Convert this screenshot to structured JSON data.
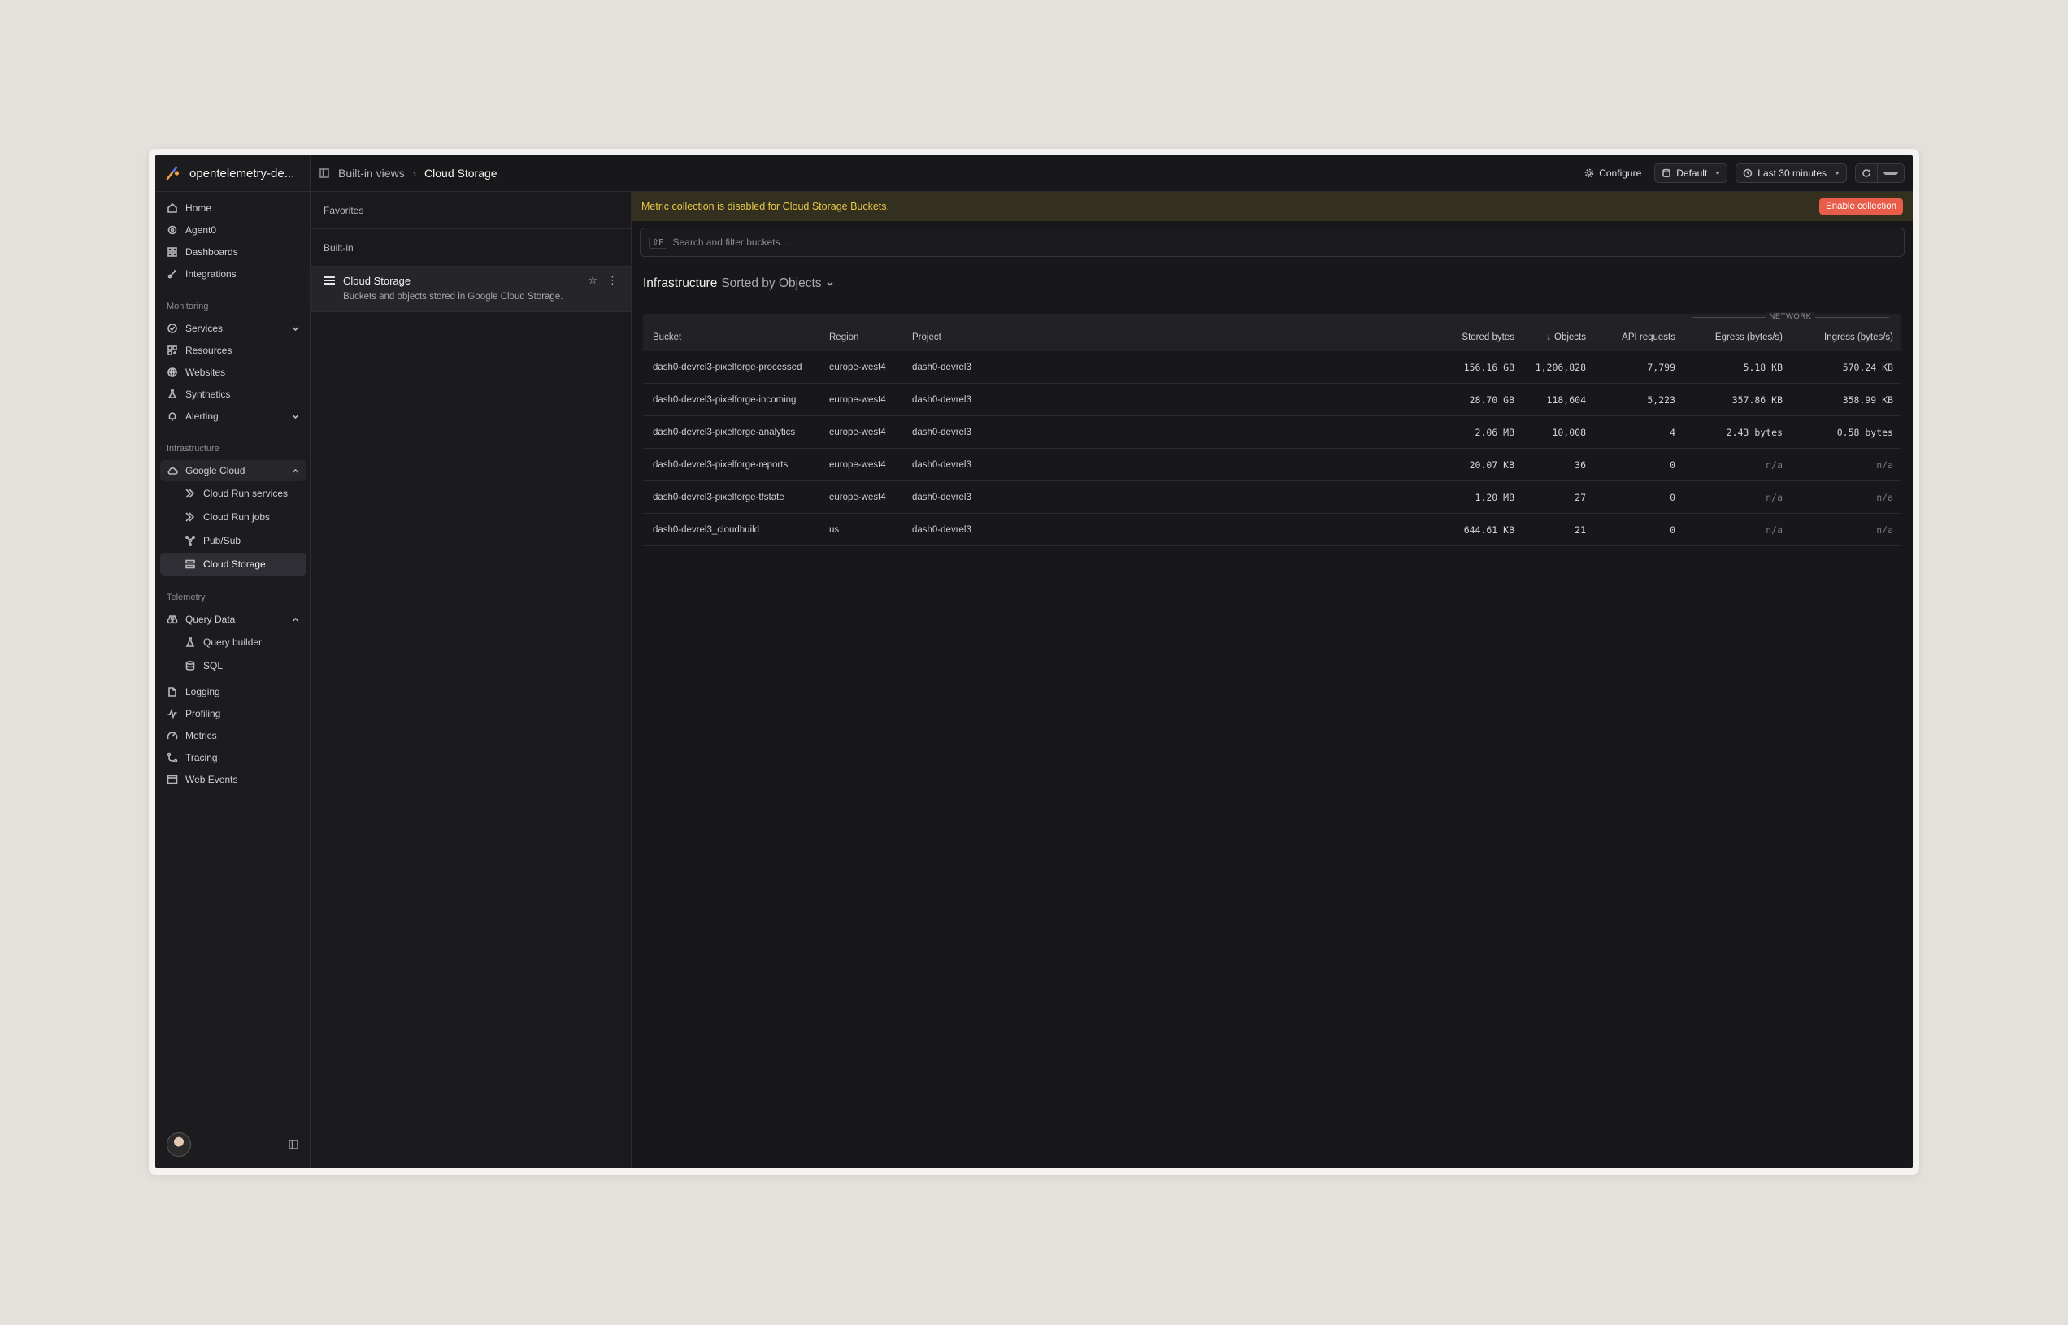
{
  "org": {
    "name": "opentelemetry-de..."
  },
  "sidebar": {
    "top_items": [
      {
        "label": "Home",
        "icon": "home-icon"
      },
      {
        "label": "Agent0",
        "icon": "agent-icon"
      },
      {
        "label": "Dashboards",
        "icon": "dashboards-icon"
      },
      {
        "label": "Integrations",
        "icon": "integrations-icon"
      }
    ],
    "monitoring": {
      "title": "Monitoring",
      "items": [
        {
          "label": "Services",
          "icon": "services-icon"
        },
        {
          "label": "Resources",
          "icon": "resources-icon"
        },
        {
          "label": "Websites",
          "icon": "globe-icon"
        },
        {
          "label": "Synthetics",
          "icon": "synthetics-icon"
        },
        {
          "label": "Alerting",
          "icon": "bell-icon"
        }
      ]
    },
    "infrastructure": {
      "title": "Infrastructure",
      "group": "Google Cloud",
      "items": [
        {
          "label": "Cloud Run services"
        },
        {
          "label": "Cloud Run jobs"
        },
        {
          "label": "Pub/Sub"
        },
        {
          "label": "Cloud Storage"
        }
      ]
    },
    "telemetry": {
      "title": "Telemetry",
      "group": "Query Data",
      "sub_items": [
        {
          "label": "Query builder"
        },
        {
          "label": "SQL"
        }
      ],
      "items": [
        {
          "label": "Logging"
        },
        {
          "label": "Profiling"
        },
        {
          "label": "Metrics"
        },
        {
          "label": "Tracing"
        },
        {
          "label": "Web Events"
        }
      ]
    }
  },
  "breadcrumb": {
    "parent": "Built-in views",
    "separator": "›",
    "current": "Cloud Storage"
  },
  "toolbar": {
    "configure": "Configure",
    "dataset": "Default",
    "time_range": "Last 30 minutes"
  },
  "views": {
    "favorites": "Favorites",
    "builtin": "Built-in",
    "card": {
      "title": "Cloud Storage",
      "desc": "Buckets and objects stored in Google Cloud Storage."
    }
  },
  "banner": {
    "text": "Metric collection is disabled for Cloud Storage Buckets.",
    "button": "Enable collection"
  },
  "search": {
    "shortcut": "⇧F",
    "placeholder": "Search and filter buckets..."
  },
  "section": {
    "title": "Infrastructure",
    "sort": "Sorted by Objects"
  },
  "table": {
    "group_label": "NETWORK",
    "columns": {
      "bucket": "Bucket",
      "region": "Region",
      "project": "Project",
      "stored": "Stored bytes",
      "objects": "Objects",
      "api": "API requests",
      "egress": "Egress (bytes/s)",
      "ingress": "Ingress (bytes/s)"
    },
    "rows": [
      {
        "bucket": "dash0-devrel3-pixelforge-processed",
        "region": "europe-west4",
        "project": "dash0-devrel3",
        "stored": "156.16 GB",
        "objects": "1,206,828",
        "api": "7,799",
        "egress": "5.18 KB",
        "ingress": "570.24 KB"
      },
      {
        "bucket": "dash0-devrel3-pixelforge-incoming",
        "region": "europe-west4",
        "project": "dash0-devrel3",
        "stored": "28.70 GB",
        "objects": "118,604",
        "api": "5,223",
        "egress": "357.86 KB",
        "ingress": "358.99 KB"
      },
      {
        "bucket": "dash0-devrel3-pixelforge-analytics",
        "region": "europe-west4",
        "project": "dash0-devrel3",
        "stored": "2.06 MB",
        "objects": "10,008",
        "api": "4",
        "egress": "2.43 bytes",
        "ingress": "0.58 bytes"
      },
      {
        "bucket": "dash0-devrel3-pixelforge-reports",
        "region": "europe-west4",
        "project": "dash0-devrel3",
        "stored": "20.07 KB",
        "objects": "36",
        "api": "0",
        "egress": "n/a",
        "ingress": "n/a"
      },
      {
        "bucket": "dash0-devrel3-pixelforge-tfstate",
        "region": "europe-west4",
        "project": "dash0-devrel3",
        "stored": "1.20 MB",
        "objects": "27",
        "api": "0",
        "egress": "n/a",
        "ingress": "n/a"
      },
      {
        "bucket": "dash0-devrel3_cloudbuild",
        "region": "us",
        "project": "dash0-devrel3",
        "stored": "644.61 KB",
        "objects": "21",
        "api": "0",
        "egress": "n/a",
        "ingress": "n/a"
      }
    ]
  },
  "colors": {
    "accent": "#e85d4a",
    "banner_text": "#e8c948",
    "background": "#18181b"
  }
}
